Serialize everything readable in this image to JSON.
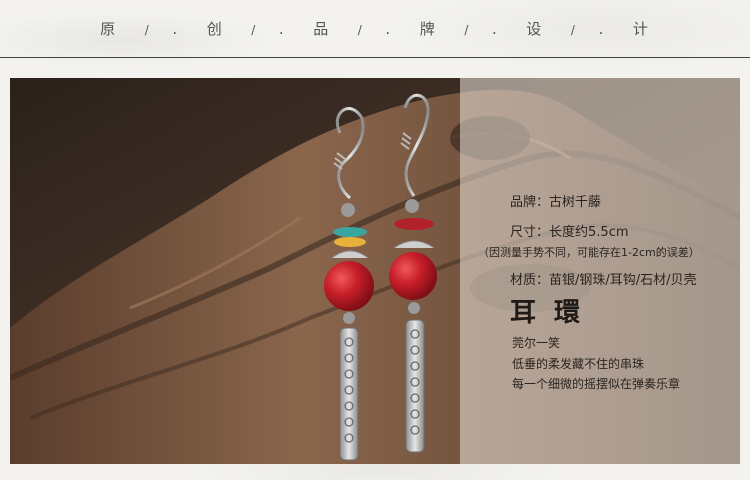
{
  "header": {
    "tagline_chars": [
      "原",
      "/",
      ".",
      "创",
      "/",
      ".",
      "品",
      "/",
      ".",
      "牌",
      "/",
      ".",
      "设",
      "/",
      ".",
      "计"
    ]
  },
  "product": {
    "brand_label": "品牌：",
    "brand_value": "古树千藤",
    "size_label": "尺寸：",
    "size_value": "长度约5.5cm",
    "size_note": "（因测量手势不同，可能存在1-2cm的误差）",
    "material_label": "材质：",
    "material_value": "苗银/钢珠/耳钩/石材/贝壳",
    "name": "耳環",
    "poem_lines": [
      "莞尔一笑",
      "低垂的柔发藏不住的串珠",
      "每一个细微的摇摆似在弹奏乐章"
    ]
  },
  "colors": {
    "wood": "#6b4a36",
    "bead_red": "#c81f2a",
    "silver": "#c9c9c9",
    "turquoise": "#3aa6a0",
    "yellow": "#e8b23a"
  }
}
